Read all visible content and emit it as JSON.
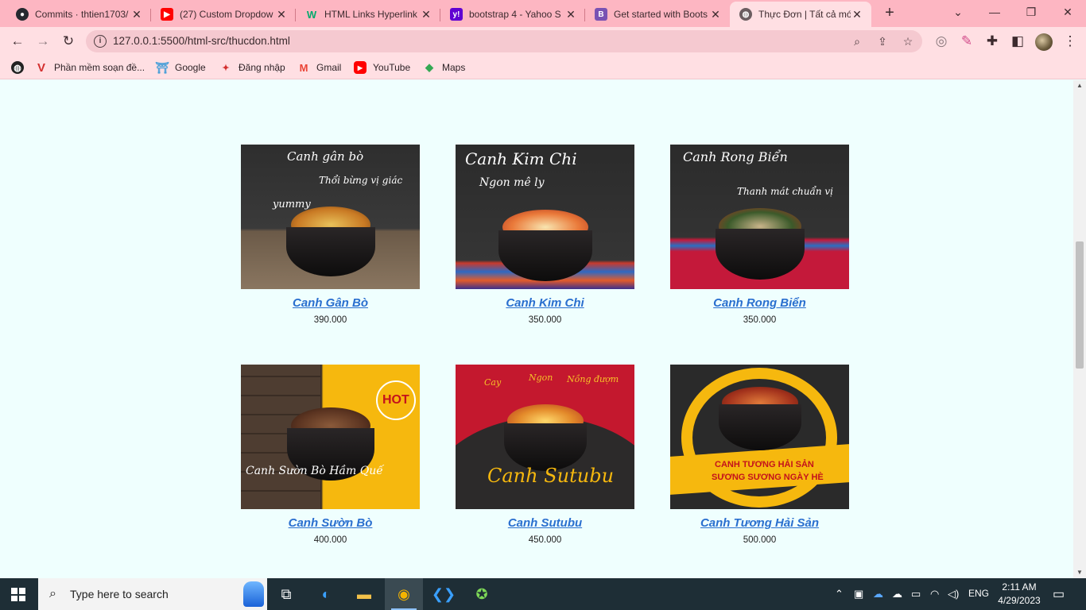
{
  "browser": {
    "tabs": [
      {
        "title": "Commits · thtien1703/",
        "icon": "github-icon",
        "active": false
      },
      {
        "title": "(27) Custom Dropdow",
        "icon": "youtube-icon",
        "active": false
      },
      {
        "title": "HTML Links Hyperlink",
        "icon": "w3schools-icon",
        "active": false
      },
      {
        "title": "bootstrap 4 - Yahoo S",
        "icon": "yahoo-icon",
        "active": false
      },
      {
        "title": "Get started with Boots",
        "icon": "bootstrap-icon",
        "active": false
      },
      {
        "title": "Thực Đơn | Tất cả món",
        "icon": "globe-icon",
        "active": true
      }
    ],
    "new_tab_label": "+",
    "url": "127.0.0.1:5500/html-src/thucdon.html",
    "bookmarks": [
      {
        "label": "",
        "icon": "globe-icon"
      },
      {
        "label": "Phần mềm soạn đề...",
        "icon": "v-logo-icon"
      },
      {
        "label": "Google",
        "icon": "google-icon"
      },
      {
        "label": "Đăng nhập",
        "icon": "login-icon"
      },
      {
        "label": "Gmail",
        "icon": "gmail-icon"
      },
      {
        "label": "YouTube",
        "icon": "youtube-icon"
      },
      {
        "label": "Maps",
        "icon": "maps-icon"
      }
    ]
  },
  "menu": {
    "items": [
      {
        "name": "Canh Gân Bò",
        "price": "390.000",
        "overlay": [
          "Canh gân bò",
          "Thổi bừng vị giác",
          "yummy"
        ]
      },
      {
        "name": "Canh Kim Chi",
        "price": "350.000",
        "overlay": [
          "Canh Kim Chi",
          "Ngon mê ly"
        ]
      },
      {
        "name": "Canh Rong Biển",
        "price": "350.000",
        "overlay": [
          "Canh Rong Biển",
          "Thanh mát chuẩn vị"
        ]
      },
      {
        "name": "Canh Sườn Bò",
        "price": "400.000",
        "overlay": [
          "Canh Sườn Bò Hầm Quế",
          "HOT"
        ]
      },
      {
        "name": "Canh Sutubu",
        "price": "450.000",
        "overlay": [
          "Cay",
          "Ngon",
          "Nồng đượm",
          "Canh Sutubu"
        ]
      },
      {
        "name": "Canh Tương Hải Sản",
        "price": "500.000",
        "overlay": [
          "CANH TƯƠNG HẢI SẢN",
          "SƯƠNG SƯƠNG NGÀY HÈ"
        ]
      }
    ]
  },
  "taskbar": {
    "search_placeholder": "Type here to search",
    "language": "ENG",
    "time": "2:11 AM",
    "date": "4/29/2023"
  }
}
